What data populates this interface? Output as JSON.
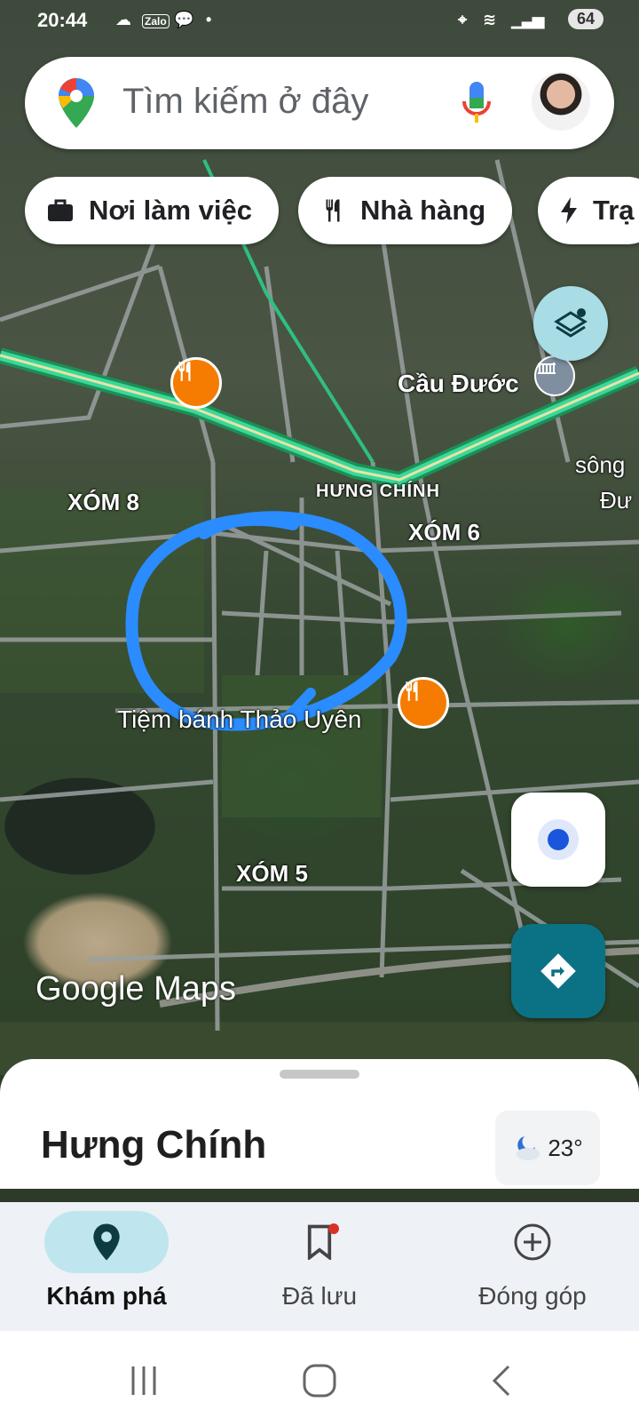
{
  "status_bar": {
    "time": "20:44",
    "battery": "64"
  },
  "search": {
    "placeholder": "Tìm kiếm ở đây"
  },
  "chips": [
    {
      "label": "Nơi làm việc",
      "icon": "briefcase-icon"
    },
    {
      "label": "Nhà hàng",
      "icon": "fork-knife-icon"
    },
    {
      "label": "Trạ",
      "icon": "bolt-icon"
    }
  ],
  "map": {
    "labels": {
      "cau_duoc": "Cầu Đước",
      "song": "sông",
      "song2": "Đư",
      "hung_chinh": "HƯNG CHÍNH",
      "xom8": "XÓM 8",
      "xom6": "XÓM 6",
      "tiem_banh": "Tiệm bánh Thảo Uyên",
      "xom5": "XÓM 5"
    },
    "brand": "Google Maps"
  },
  "sheet": {
    "place_name": "Hưng Chính",
    "temperature": "23°"
  },
  "bottom_nav": {
    "items": [
      {
        "label": "Khám phá",
        "icon": "location-pin-icon",
        "active": true
      },
      {
        "label": "Đã lưu",
        "icon": "bookmark-icon",
        "active": false
      },
      {
        "label": "Đóng góp",
        "icon": "plus-circle-icon",
        "active": false
      }
    ]
  },
  "colors": {
    "accent": "#0b7285",
    "highway": "#2ec27e",
    "poi": "#f57c00",
    "annotation": "#2a8cff"
  }
}
